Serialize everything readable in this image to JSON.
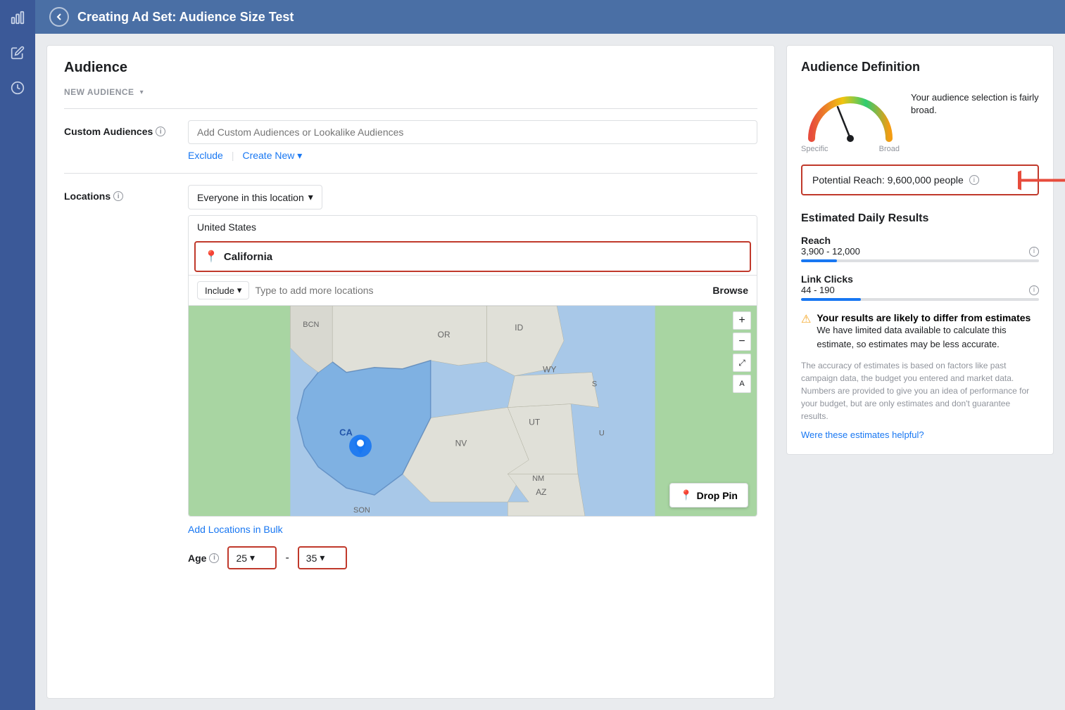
{
  "header": {
    "title": "Creating Ad Set: Audience Size Test",
    "back_label": "◀"
  },
  "sidebar": {
    "icons": [
      {
        "name": "chart-icon",
        "symbol": "📊"
      },
      {
        "name": "edit-icon",
        "symbol": "✏"
      },
      {
        "name": "clock-icon",
        "symbol": "🕐"
      }
    ]
  },
  "left_panel": {
    "title": "Audience",
    "new_audience": {
      "label": "NEW AUDIENCE"
    },
    "custom_audiences": {
      "label": "Custom Audiences",
      "placeholder": "Add Custom Audiences or Lookalike Audiences",
      "exclude_link": "Exclude",
      "create_new_link": "Create New",
      "create_arrow": "▾"
    },
    "locations": {
      "label": "Locations",
      "dropdown_label": "Everyone in this location",
      "dropdown_arrow": "▾",
      "search_value": "United States",
      "california": "California",
      "include_label": "Include",
      "include_arrow": "▾",
      "include_placeholder": "Type to add more locations",
      "browse_label": "Browse",
      "add_bulk_link": "Add Locations in Bulk",
      "drop_pin_label": "Drop Pin"
    },
    "age": {
      "label": "Age",
      "from": "25",
      "to": "35",
      "arrow": "▾"
    }
  },
  "right_panel": {
    "audience_definition": {
      "title": "Audience Definition",
      "gauge_specific_label": "Specific",
      "gauge_broad_label": "Broad",
      "description": "Your audience selection is fairly broad.",
      "potential_reach_label": "Potential Reach: 9,600,000 people",
      "info_icon": "ℹ"
    },
    "estimated_daily": {
      "title": "Estimated Daily Results",
      "reach": {
        "label": "Reach",
        "value": "3,900 - 12,000",
        "bar_percent": 15
      },
      "link_clicks": {
        "label": "Link Clicks",
        "value": "44 - 190",
        "bar_percent": 25
      },
      "warning_title": "Your results are likely to differ from estimates",
      "warning_body": "We have limited data available to calculate this estimate, so estimates may be less accurate.",
      "disclaimer": "The accuracy of estimates is based on factors like past campaign data, the budget you entered and market data. Numbers are provided to give you an idea of performance for your budget, but are only estimates and don't guarantee results.",
      "helpful_link": "Were these estimates helpful?"
    }
  }
}
